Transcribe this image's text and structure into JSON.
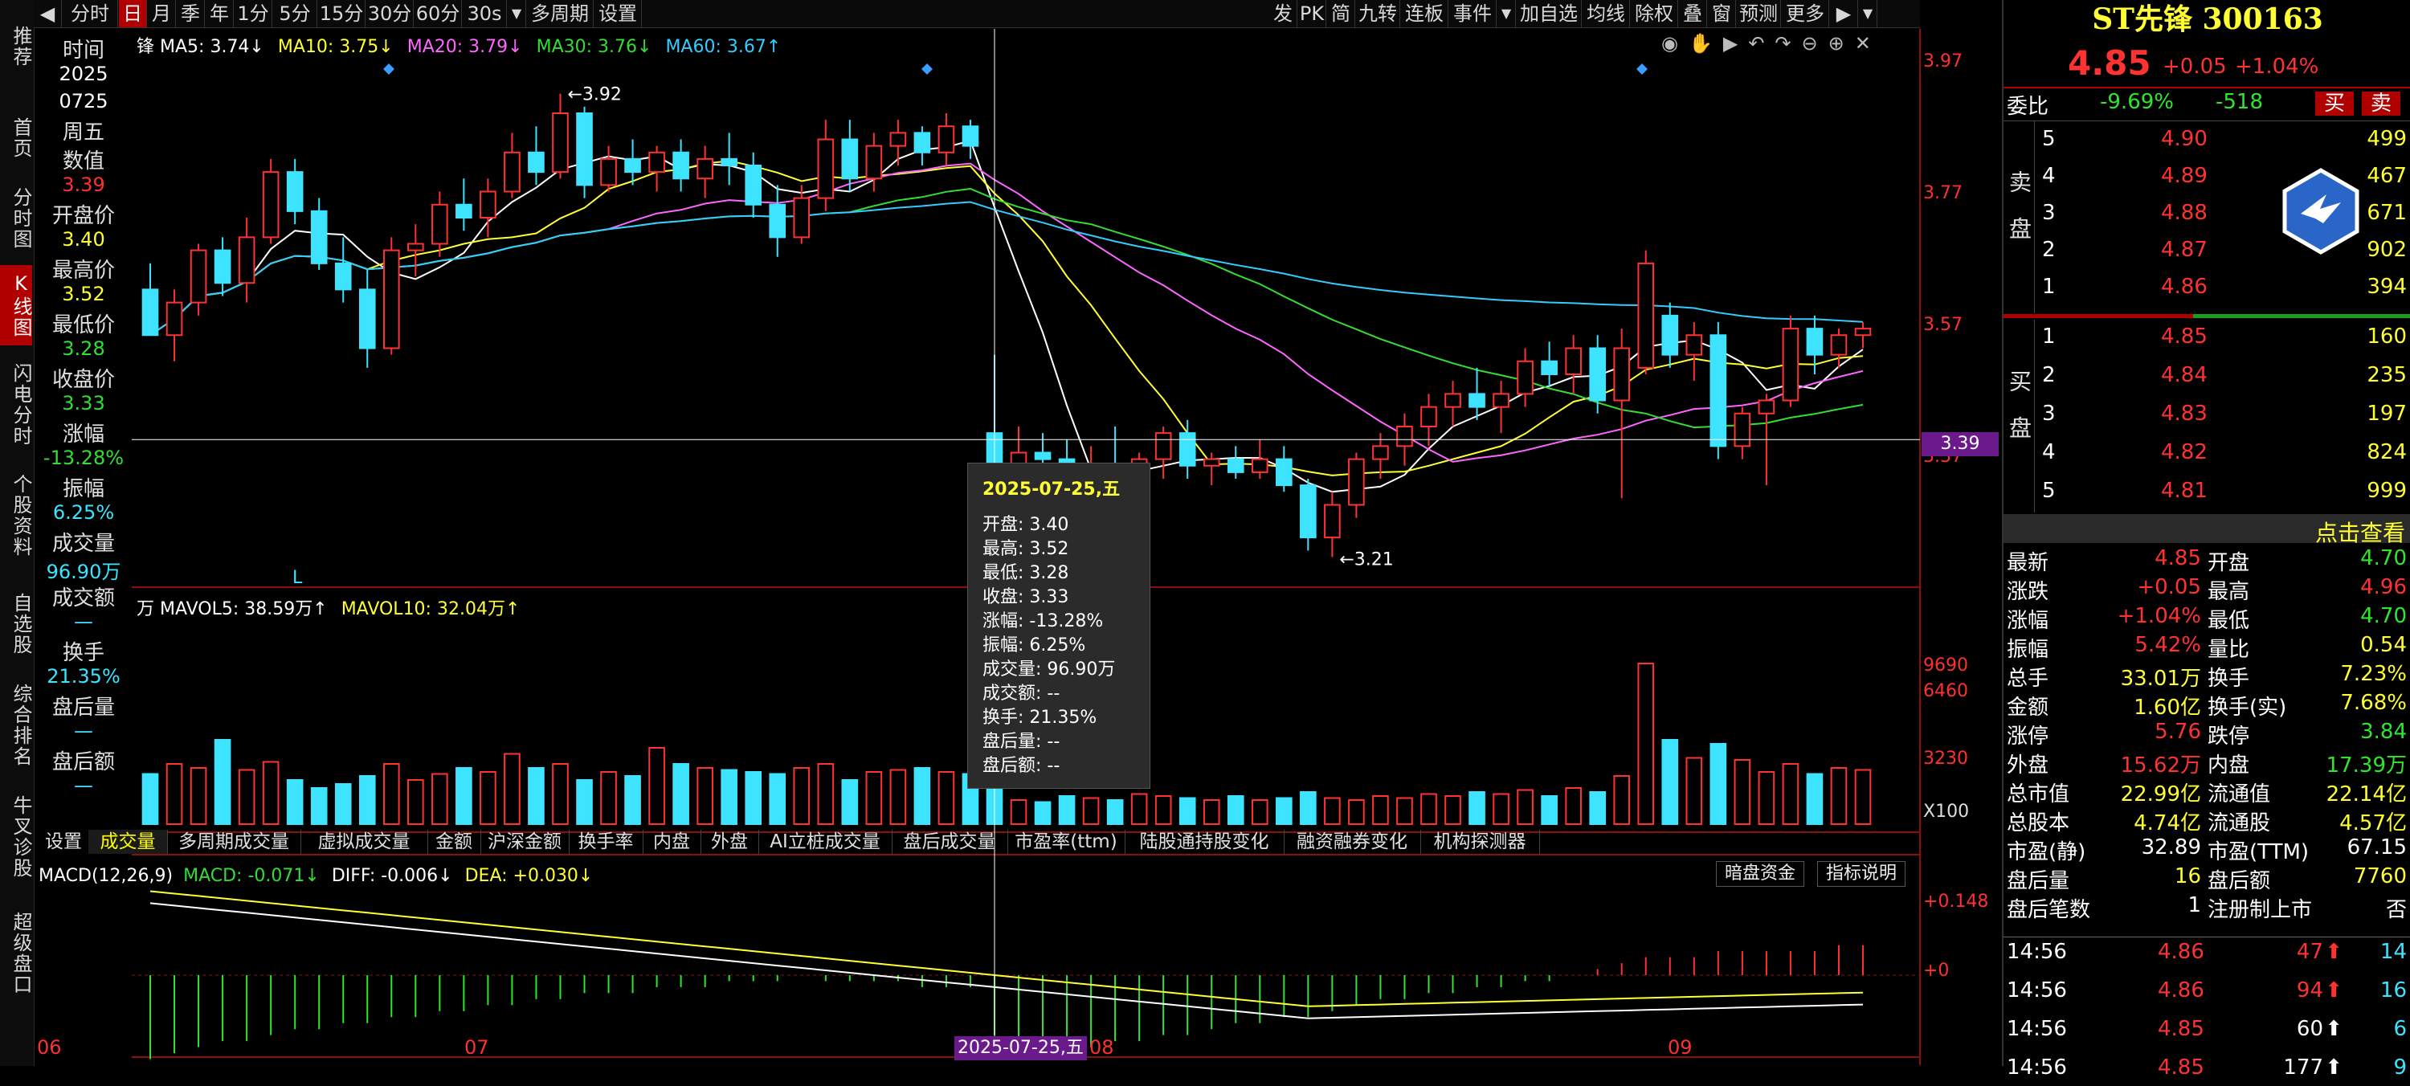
{
  "left_nav": [
    {
      "label": "推荐",
      "active": false
    },
    {
      "label": "首页",
      "active": false
    },
    {
      "label": "分时图",
      "active": false
    },
    {
      "label": "K线图",
      "active": true
    },
    {
      "label": "闪电分时",
      "active": false
    },
    {
      "label": "个股资料",
      "active": false
    },
    {
      "label": "自选股",
      "active": false
    },
    {
      "label": "综合排名",
      "active": false
    },
    {
      "label": "牛叉诊股",
      "active": false
    },
    {
      "label": "超级盘口",
      "active": false
    }
  ],
  "toolbar": {
    "left": [
      "分时",
      "日",
      "月",
      "季",
      "年",
      "1分",
      "5分",
      "15分",
      "30分",
      "60分",
      "30s",
      "多周期",
      "设置"
    ],
    "right": [
      "发",
      "PK",
      "简",
      "九转",
      "连板",
      "事件",
      "加自选",
      "均线",
      "除权",
      "叠",
      "窗",
      "预测",
      "更多"
    ]
  },
  "info_panel": {
    "time_label": "时间",
    "date_year": "2025",
    "date_md": "0725",
    "weekday": "周五",
    "value_label": "数值",
    "value": "3.39",
    "open_label": "开盘价",
    "open": "3.40",
    "high_label": "最高价",
    "high": "3.52",
    "low_label": "最低价",
    "low": "3.28",
    "close_label": "收盘价",
    "close": "3.33",
    "change_label": "涨幅",
    "change": "-13.28%",
    "amp_label": "振幅",
    "amp": "6.25%",
    "vol_label": "成交量",
    "vol": "96.90万",
    "amount_label": "成交额",
    "amount": "—",
    "turnover_label": "换手",
    "turnover": "21.35%",
    "after_vol_label": "盘后量",
    "after_vol": "—",
    "after_amt_label": "盘后额",
    "after_amt": "—"
  },
  "ma_legend": {
    "prefix": "锋",
    "ma5": "MA5: 3.74↓",
    "ma10": "MA10: 3.75↓",
    "ma20": "MA20: 3.79↓",
    "ma30": "MA30: 3.76↓",
    "ma60": "MA60: 3.67↑"
  },
  "vol_legend": {
    "prefix": "万",
    "mavol5": "MAVOL5: 38.59万↑",
    "mavol10": "MAVOL10: 32.04万↑"
  },
  "macd_legend": {
    "name": "MACD(12,26,9)",
    "macd": "MACD: -0.071↓",
    "diff": "DIFF: -0.006↓",
    "dea": "DEA: +0.030↓"
  },
  "macd_buttons": [
    "暗盘资金",
    "指标说明"
  ],
  "price_axis": [
    "3.97",
    "3.77",
    "3.57",
    "3.37"
  ],
  "vol_axis": [
    "9690",
    "6460",
    "3230",
    "X100"
  ],
  "macd_axis": [
    "+0.148",
    "+0"
  ],
  "crosshair_value": "3.39",
  "high_marker": "3.92",
  "low_marker": "3.21",
  "l_marker": "L",
  "date_axis": [
    "06",
    "07",
    "08",
    "09"
  ],
  "crosshair_date": "2025-07-25,五",
  "bottom_tabs": [
    "设置",
    "成交量",
    "多周期成交量",
    "虚拟成交量",
    "金额",
    "沪深金额",
    "换手率",
    "内盘",
    "外盘",
    "AI立桩成交量",
    "盘后成交量",
    "市盈率(ttm)",
    "陆股通持股变化",
    "融资融券变化",
    "机构探测器"
  ],
  "tooltip": {
    "title": "2025-07-25,五",
    "rows": [
      "开盘: 3.40",
      "最高: 3.52",
      "最低: 3.28",
      "收盘: 3.33",
      "涨幅: -13.28%",
      "振幅: 6.25%",
      "成交量: 96.90万",
      "成交额: --",
      "换手: 21.35%",
      "盘后量: --",
      "盘后额: --"
    ]
  },
  "quote": {
    "name": "ST先锋 300163",
    "price": "4.85",
    "chg": "+0.05",
    "pct": "+1.04%",
    "weibi_label": "委比",
    "weibi": "-9.69%",
    "weicha": "-518",
    "buy_btn": "买",
    "sell_btn": "卖",
    "sell_label": "卖盘",
    "buy_label": "买盘",
    "asks": [
      [
        "5",
        "4.90",
        "499"
      ],
      [
        "4",
        "4.89",
        "467"
      ],
      [
        "3",
        "4.88",
        "671"
      ],
      [
        "2",
        "4.87",
        "902"
      ],
      [
        "1",
        "4.86",
        "394"
      ]
    ],
    "bids": [
      [
        "1",
        "4.85",
        "160"
      ],
      [
        "2",
        "4.84",
        "235"
      ],
      [
        "3",
        "4.83",
        "197"
      ],
      [
        "4",
        "4.82",
        "824"
      ],
      [
        "5",
        "4.81",
        "999"
      ]
    ],
    "click_view": "点击查看",
    "stats": [
      [
        "最新",
        "4.85",
        "开盘",
        "4.70"
      ],
      [
        "涨跌",
        "+0.05",
        "最高",
        "4.96"
      ],
      [
        "涨幅",
        "+1.04%",
        "最低",
        "4.70"
      ],
      [
        "振幅",
        "5.42%",
        "量比",
        "0.54"
      ],
      [
        "总手",
        "33.01万",
        "换手",
        "7.23%"
      ],
      [
        "金额",
        "1.60亿",
        "换手(实)",
        "7.68%"
      ],
      [
        "涨停",
        "5.76",
        "跌停",
        "3.84"
      ],
      [
        "外盘",
        "15.62万",
        "内盘",
        "17.39万"
      ],
      [
        "总市值",
        "22.99亿",
        "流通值",
        "22.14亿"
      ],
      [
        "总股本",
        "4.74亿",
        "流通股",
        "4.57亿"
      ],
      [
        "市盈(静)",
        "32.89",
        "市盈(TTM)",
        "67.15"
      ],
      [
        "盘后量",
        "16",
        "盘后额",
        "7760"
      ],
      [
        "盘后笔数",
        "1",
        "注册制上市",
        "否"
      ]
    ],
    "ticks": [
      [
        "14:56",
        "4.86",
        "47",
        "14"
      ],
      [
        "14:56",
        "4.86",
        "94",
        "16"
      ],
      [
        "14:56",
        "4.85",
        "60",
        "6"
      ],
      [
        "14:56",
        "4.85",
        "177",
        "9"
      ]
    ]
  },
  "colors": {
    "up": "#ff3232",
    "down": "#3de3ff",
    "ma5": "#ffffff",
    "ma10": "#ffff33",
    "ma20": "#ff66ff",
    "ma30": "#33dd33",
    "ma60": "#33ccff"
  },
  "chart_data": {
    "type": "candlestick",
    "ylim": [
      3.17,
      3.97
    ],
    "ohlc": [
      [
        3.62,
        3.66,
        3.55,
        3.55
      ],
      [
        3.55,
        3.62,
        3.51,
        3.6
      ],
      [
        3.6,
        3.69,
        3.58,
        3.68
      ],
      [
        3.68,
        3.7,
        3.61,
        3.63
      ],
      [
        3.63,
        3.73,
        3.6,
        3.7
      ],
      [
        3.7,
        3.82,
        3.69,
        3.8
      ],
      [
        3.8,
        3.82,
        3.72,
        3.74
      ],
      [
        3.74,
        3.76,
        3.65,
        3.66
      ],
      [
        3.66,
        3.7,
        3.6,
        3.62
      ],
      [
        3.62,
        3.65,
        3.5,
        3.53
      ],
      [
        3.53,
        3.7,
        3.52,
        3.68
      ],
      [
        3.68,
        3.72,
        3.64,
        3.69
      ],
      [
        3.69,
        3.77,
        3.67,
        3.75
      ],
      [
        3.75,
        3.79,
        3.71,
        3.73
      ],
      [
        3.73,
        3.79,
        3.7,
        3.77
      ],
      [
        3.77,
        3.86,
        3.76,
        3.83
      ],
      [
        3.83,
        3.87,
        3.78,
        3.8
      ],
      [
        3.8,
        3.92,
        3.79,
        3.89
      ],
      [
        3.89,
        3.9,
        3.76,
        3.78
      ],
      [
        3.78,
        3.84,
        3.77,
        3.82
      ],
      [
        3.82,
        3.85,
        3.78,
        3.8
      ],
      [
        3.8,
        3.84,
        3.77,
        3.83
      ],
      [
        3.83,
        3.85,
        3.77,
        3.79
      ],
      [
        3.79,
        3.84,
        3.76,
        3.82
      ],
      [
        3.82,
        3.86,
        3.78,
        3.81
      ],
      [
        3.81,
        3.83,
        3.73,
        3.75
      ],
      [
        3.75,
        3.78,
        3.67,
        3.7
      ],
      [
        3.7,
        3.78,
        3.69,
        3.76
      ],
      [
        3.76,
        3.88,
        3.74,
        3.85
      ],
      [
        3.85,
        3.88,
        3.77,
        3.79
      ],
      [
        3.79,
        3.86,
        3.77,
        3.84
      ],
      [
        3.84,
        3.88,
        3.81,
        3.86
      ],
      [
        3.86,
        3.87,
        3.81,
        3.83
      ],
      [
        3.83,
        3.89,
        3.81,
        3.87
      ],
      [
        3.87,
        3.88,
        3.82,
        3.84
      ],
      [
        3.4,
        3.52,
        3.28,
        3.33
      ],
      [
        3.33,
        3.41,
        3.3,
        3.37
      ],
      [
        3.37,
        3.4,
        3.32,
        3.36
      ],
      [
        3.36,
        3.39,
        3.27,
        3.31
      ],
      [
        3.31,
        3.38,
        3.3,
        3.35
      ],
      [
        3.35,
        3.41,
        3.31,
        3.33
      ],
      [
        3.33,
        3.37,
        3.31,
        3.36
      ],
      [
        3.36,
        3.41,
        3.33,
        3.4
      ],
      [
        3.4,
        3.42,
        3.33,
        3.35
      ],
      [
        3.35,
        3.37,
        3.32,
        3.36
      ],
      [
        3.36,
        3.38,
        3.33,
        3.34
      ],
      [
        3.34,
        3.39,
        3.33,
        3.36
      ],
      [
        3.36,
        3.38,
        3.31,
        3.32
      ],
      [
        3.32,
        3.33,
        3.22,
        3.24
      ],
      [
        3.24,
        3.31,
        3.21,
        3.29
      ],
      [
        3.29,
        3.37,
        3.27,
        3.36
      ],
      [
        3.36,
        3.4,
        3.33,
        3.38
      ],
      [
        3.38,
        3.43,
        3.35,
        3.41
      ],
      [
        3.41,
        3.46,
        3.38,
        3.44
      ],
      [
        3.44,
        3.48,
        3.41,
        3.46
      ],
      [
        3.46,
        3.5,
        3.42,
        3.44
      ],
      [
        3.44,
        3.48,
        3.4,
        3.46
      ],
      [
        3.46,
        3.53,
        3.44,
        3.51
      ],
      [
        3.51,
        3.54,
        3.47,
        3.49
      ],
      [
        3.49,
        3.55,
        3.46,
        3.53
      ],
      [
        3.53,
        3.55,
        3.43,
        3.45
      ],
      [
        3.45,
        3.56,
        3.3,
        3.53
      ],
      [
        3.5,
        3.68,
        3.49,
        3.66
      ],
      [
        3.58,
        3.6,
        3.5,
        3.52
      ],
      [
        3.52,
        3.57,
        3.48,
        3.55
      ],
      [
        3.55,
        3.57,
        3.36,
        3.38
      ],
      [
        3.38,
        3.44,
        3.36,
        3.43
      ],
      [
        3.43,
        3.46,
        3.32,
        3.45
      ],
      [
        3.45,
        3.58,
        3.44,
        3.56
      ],
      [
        3.56,
        3.58,
        3.49,
        3.52
      ],
      [
        3.52,
        3.56,
        3.5,
        3.55
      ],
      [
        3.55,
        3.57,
        3.53,
        3.56
      ]
    ],
    "volume": [
      25,
      30,
      28,
      42,
      27,
      31,
      22,
      18,
      20,
      24,
      30,
      22,
      25,
      28,
      26,
      35,
      28,
      30,
      22,
      26,
      24,
      38,
      30,
      28,
      27,
      26,
      25,
      28,
      30,
      22,
      26,
      27,
      28,
      26,
      25,
      97,
      12,
      11,
      14,
      13,
      12,
      15,
      14,
      13,
      12,
      14,
      12,
      13,
      16,
      13,
      12,
      14,
      13,
      15,
      14,
      16,
      15,
      17,
      14,
      18,
      16,
      24,
      80,
      42,
      33,
      40,
      32,
      26,
      30,
      25,
      28,
      27
    ],
    "macd_hist": [
      -0.14,
      -0.13,
      -0.12,
      -0.11,
      -0.11,
      -0.1,
      -0.09,
      -0.09,
      -0.08,
      -0.08,
      -0.07,
      -0.07,
      -0.06,
      -0.06,
      -0.05,
      -0.05,
      -0.04,
      -0.04,
      -0.03,
      -0.03,
      -0.03,
      -0.02,
      -0.02,
      -0.02,
      -0.01,
      -0.01,
      -0.01,
      0.0,
      -0.01,
      -0.01,
      -0.01,
      -0.01,
      -0.02,
      -0.02,
      -0.02,
      -0.1,
      -0.11,
      -0.12,
      -0.12,
      -0.12,
      -0.11,
      -0.11,
      -0.1,
      -0.1,
      -0.09,
      -0.08,
      -0.08,
      -0.07,
      -0.07,
      -0.06,
      -0.05,
      -0.04,
      -0.04,
      -0.03,
      -0.03,
      -0.02,
      -0.02,
      -0.01,
      -0.01,
      0.0,
      0.01,
      0.02,
      0.03,
      0.03,
      0.03,
      0.04,
      0.04,
      0.04,
      0.04,
      0.04,
      0.05,
      0.05
    ]
  }
}
